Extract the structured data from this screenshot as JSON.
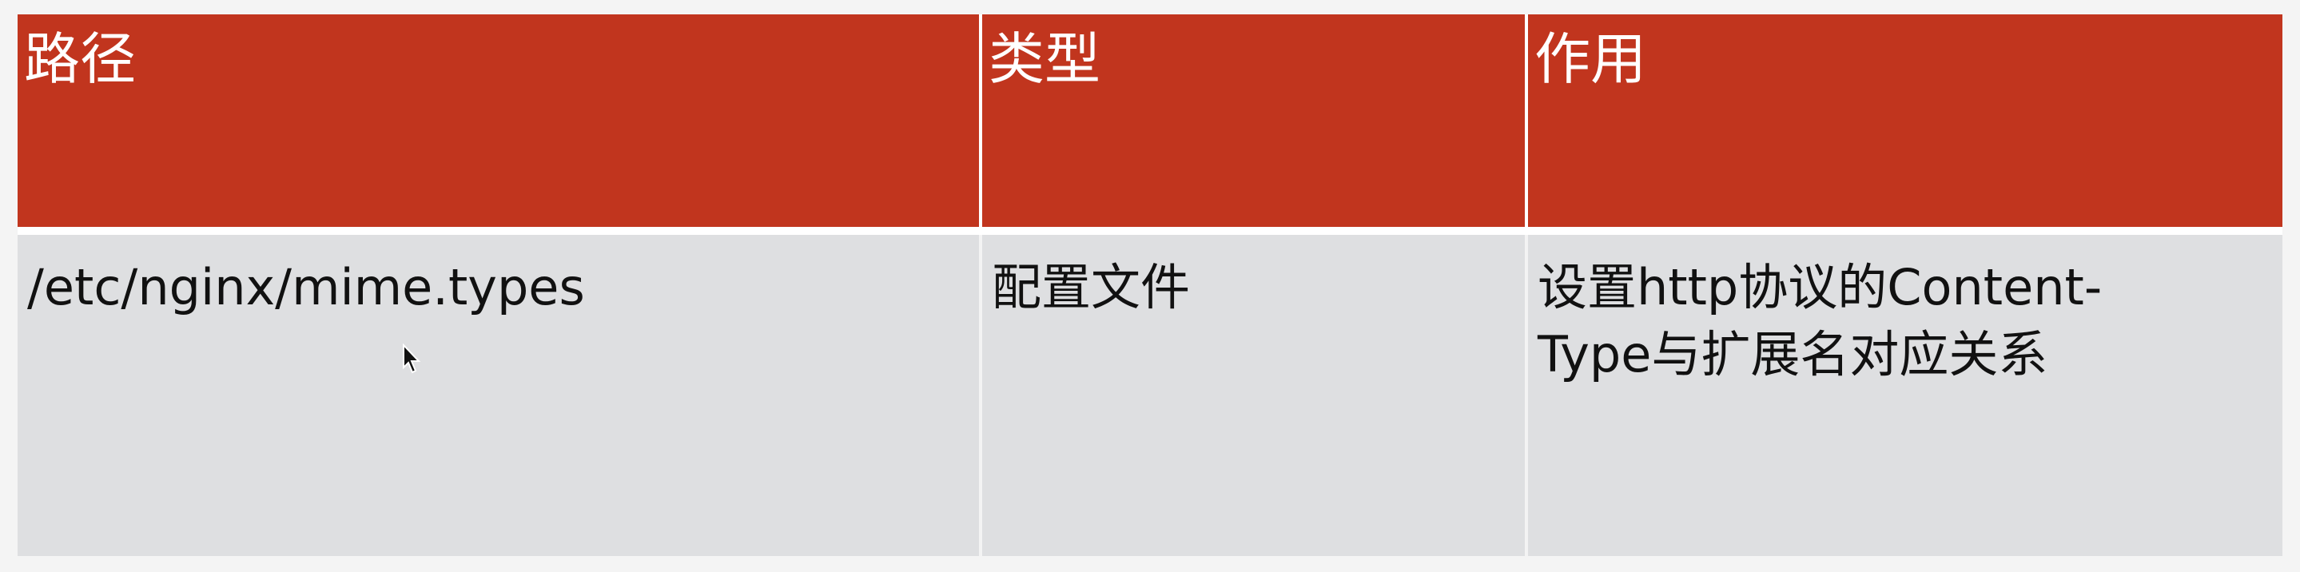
{
  "table": {
    "headers": [
      "路径",
      "类型",
      "作用"
    ],
    "rows": [
      [
        "/etc/nginx/mime.types",
        "配置文件",
        "设置http协议的Content-\nType与扩展名对应关系"
      ]
    ]
  },
  "colors": {
    "header_bg": "#c1351e",
    "body_bg": "#dedfe1",
    "header_text": "#ffffff",
    "body_text": "#111111"
  },
  "icons": {
    "cursor": "mouse-pointer-icon"
  }
}
